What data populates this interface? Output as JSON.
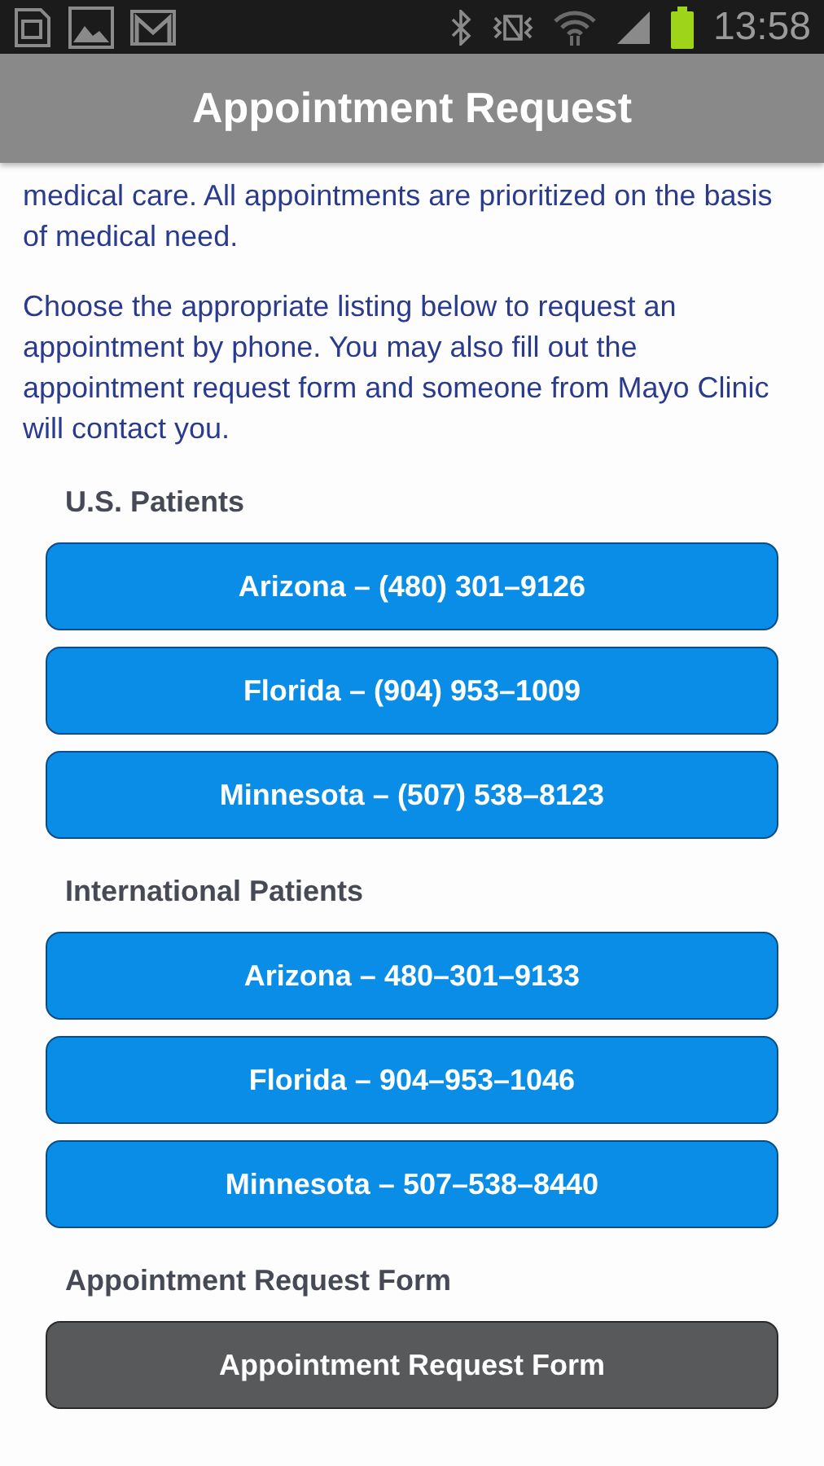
{
  "status_bar": {
    "time": "13:58"
  },
  "title": "Appointment Request",
  "paragraphs": [
    "medical care. All appointments are prioritized on the basis of medical need.",
    "Choose the appropriate listing below to request an appointment by phone. You may also fill out the appointment request form and someone from Mayo Clinic will contact you."
  ],
  "sections": [
    {
      "heading": "U.S. Patients",
      "buttons": [
        {
          "label": "Arizona – (480) 301–9126",
          "kind": "call"
        },
        {
          "label": "Florida – (904) 953–1009",
          "kind": "call"
        },
        {
          "label": "Minnesota – (507) 538–8123",
          "kind": "call"
        }
      ]
    },
    {
      "heading": "International Patients",
      "buttons": [
        {
          "label": "Arizona – 480–301–9133",
          "kind": "call"
        },
        {
          "label": "Florida – 904–953–1046",
          "kind": "call"
        },
        {
          "label": "Minnesota – 507–538–8440",
          "kind": "call"
        }
      ]
    },
    {
      "heading": "Appointment Request Form",
      "buttons": [
        {
          "label": "Appointment Request Form",
          "kind": "form"
        }
      ]
    }
  ]
}
